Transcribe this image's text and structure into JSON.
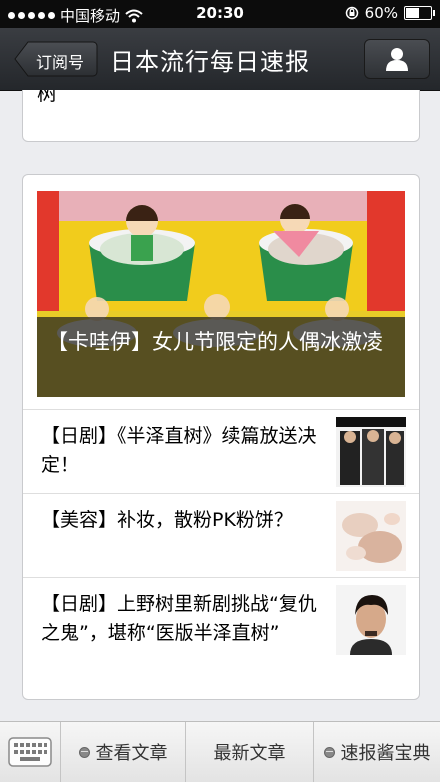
{
  "status": {
    "carrier": "中国移动",
    "time": "20:30",
    "battery": "60%",
    "battery_level": 0.6
  },
  "nav": {
    "back_label": "订阅号",
    "title": "日本流行每日速报"
  },
  "top_card": {
    "text": "树”"
  },
  "hero": {
    "caption": "【卡哇伊】女儿节限定的人偶冰激凌"
  },
  "items": [
    {
      "title": "【日剧】《半泽直树》续篇放送决定！"
    },
    {
      "title": "【美容】补妆，散粉PK粉饼？"
    },
    {
      "title": "【日剧】上野树里新剧挑战“复仇之鬼”，堪称“医版半泽直树”"
    }
  ],
  "toolbar": {
    "items": [
      "查看文章",
      "最新文章",
      "速报酱宝典"
    ]
  }
}
